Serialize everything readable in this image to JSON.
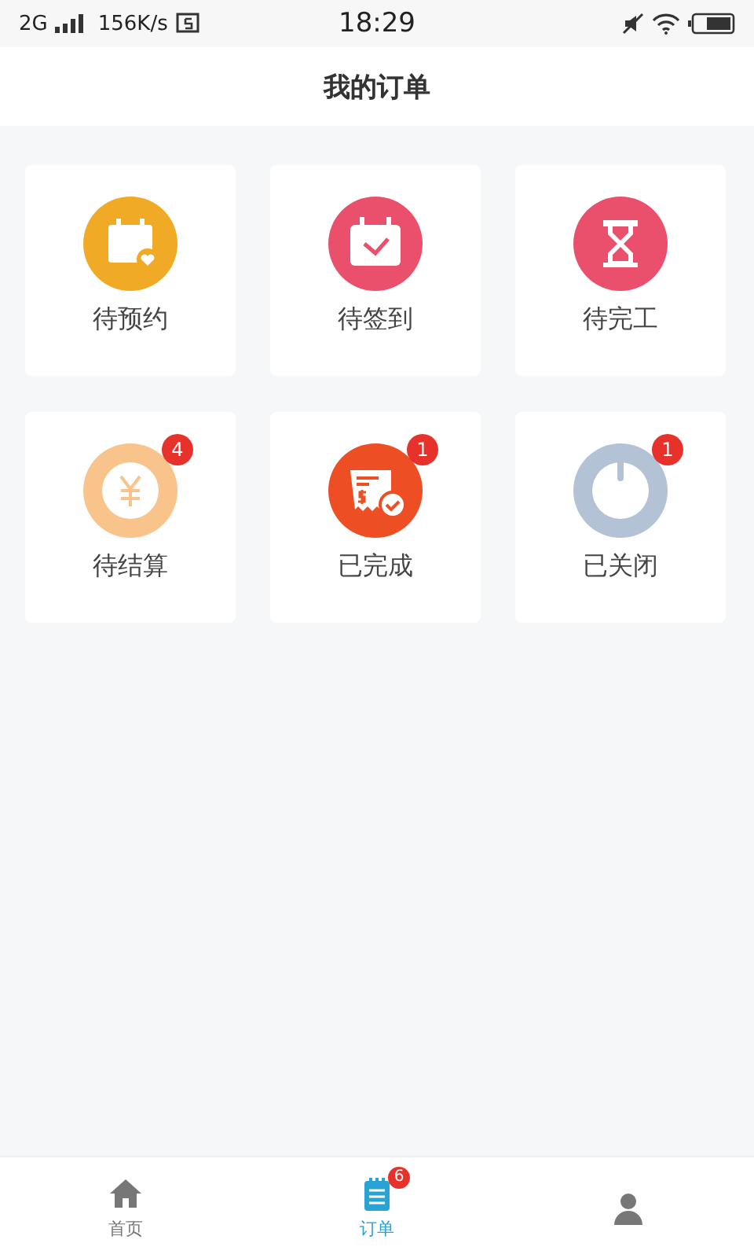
{
  "status_bar": {
    "network": "2G",
    "speed": "156K/s",
    "time": "18:29"
  },
  "header": {
    "title": "我的订单"
  },
  "orders": [
    {
      "label": "待预约",
      "kind": "booking",
      "color": "#f0aa26"
    },
    {
      "label": "待签到",
      "kind": "checkin",
      "color": "#ea4f6b"
    },
    {
      "label": "待完工",
      "kind": "working",
      "color": "#ea4f6b"
    },
    {
      "label": "待结算",
      "kind": "billing",
      "color": "#f9c48c",
      "badge": "4"
    },
    {
      "label": "已完成",
      "kind": "done",
      "color": "#ee4e24",
      "badge": "1"
    },
    {
      "label": "已关闭",
      "kind": "closed",
      "color": "#b4c2d6",
      "badge": "1"
    }
  ],
  "tabs": [
    {
      "label": "首页",
      "kind": "home",
      "selected": false
    },
    {
      "label": "订单",
      "kind": "orders",
      "selected": true,
      "badge": "6"
    },
    {
      "kind": "profile",
      "selected": false
    }
  ]
}
